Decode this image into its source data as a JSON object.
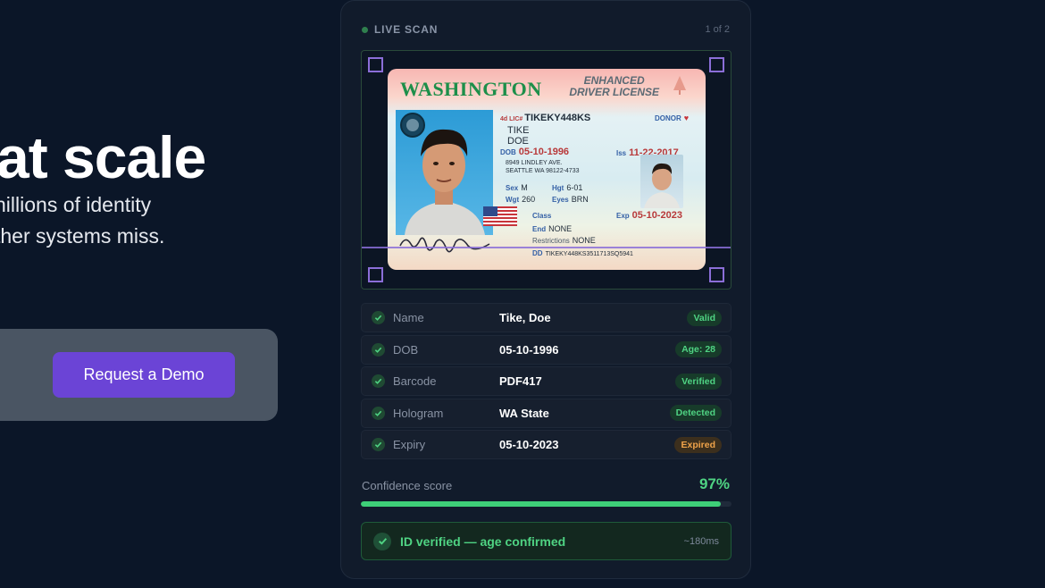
{
  "hero": {
    "title": "at scale",
    "subtitle_line1": "nillions of identity",
    "subtitle_line2": "ther systems miss.",
    "cta_label": "Request a Demo"
  },
  "card": {
    "status_label": "LIVE SCAN",
    "pager": "1 of 2",
    "license": {
      "state": "WASHINGTON",
      "type_line1": "ENHANCED",
      "type_line2": "DRIVER LICENSE",
      "lic_no_label": "4d LIC#",
      "lic_no": "TIKEKY448KS",
      "donor": "DONOR",
      "last_name": "TIKE",
      "first_name": "DOE",
      "dob_label": "DOB",
      "dob": "05-10-1996",
      "address1": "8949 LINDLEY AVE.",
      "address2": "SEATTLE WA 98122-4733",
      "iss_label": "Iss",
      "iss": "11-22-2017",
      "sex_label": "Sex",
      "sex": "M",
      "hgt_label": "Hgt",
      "hgt": "6-01",
      "wgt_label": "Wgt",
      "wgt": "260",
      "eyes_label": "Eyes",
      "eyes": "BRN",
      "class_label": "Class",
      "end_label": "End",
      "end": "NONE",
      "restr_label": "Restrictions",
      "restr": "NONE",
      "exp_label": "Exp",
      "exp": "05-10-2023",
      "dd_label": "DD",
      "dd": "TIKEKY448KS3511713SQ5941"
    },
    "rows": [
      {
        "label": "Name",
        "value": "Tike, Doe",
        "badge": "Valid",
        "badge_color": "green"
      },
      {
        "label": "DOB",
        "value": "05-10-1996",
        "badge": "Age: 28",
        "badge_color": "green"
      },
      {
        "label": "Barcode",
        "value": "PDF417",
        "badge": "Verified",
        "badge_color": "green"
      },
      {
        "label": "Hologram",
        "value": "WA State",
        "badge": "Detected",
        "badge_color": "green"
      },
      {
        "label": "Expiry",
        "value": "05-10-2023",
        "badge": "Expired",
        "badge_color": "orange"
      }
    ],
    "confidence": {
      "label": "Confidence score",
      "value": "97%",
      "fraction": 0.97
    },
    "result": {
      "text": "ID verified — age confirmed",
      "time": "~180ms"
    }
  },
  "colors": {
    "background": "#0b1628",
    "accent": "#6b44d6",
    "success": "#4fd383",
    "warning": "#f0a34a",
    "scan": "#8b6ed8"
  }
}
